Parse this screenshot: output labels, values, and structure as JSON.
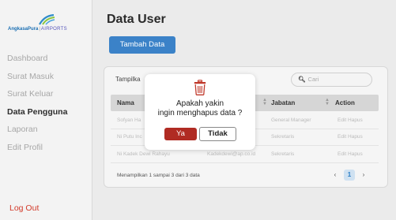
{
  "sidebar": {
    "logo": {
      "brand": "AngkasaPura",
      "separator": "|",
      "sub": "AIRPORTS",
      "icon": "angkasa-pura-logo-icon"
    },
    "items": [
      {
        "label": "Dashboard",
        "active": false
      },
      {
        "label": "Surat Masuk",
        "active": false
      },
      {
        "label": "Surat Keluar",
        "active": false
      },
      {
        "label": "Data Pengguna",
        "active": true
      },
      {
        "label": "Laporan",
        "active": false
      },
      {
        "label": "Edit Profil",
        "active": false
      }
    ],
    "logout_label": "Log Out",
    "logout_color": "#d23a2a"
  },
  "main": {
    "title": "Data User",
    "add_button_label": "Tambah Data",
    "accent_color": "#3b82c8",
    "show_label": "Tampilka",
    "search": {
      "icon": "search-icon",
      "placeholder": "Cari"
    },
    "table": {
      "columns": [
        "Nama",
        "Jabatan",
        "Action"
      ],
      "rows": [
        {
          "name": "Sofyan Ha",
          "email": "",
          "jabatan": "General Manager",
          "action": "Edit Hapus"
        },
        {
          "name": "Ni Putu Inc",
          "email": "",
          "jabatan": "Sekretaris",
          "action": "Edit Hapus"
        },
        {
          "name": "Ni Kadek Dewi Rahayu",
          "email": "Kadekdewi@ap.co.id",
          "jabatan": "Sekretaris",
          "action": "Edit Hapus"
        }
      ]
    },
    "info_text": "Menampilkan 1 sampai 3 dari 3 data",
    "pagination": {
      "prev": "‹",
      "current": "1",
      "next": "›"
    }
  },
  "modal": {
    "icon": "trash-icon",
    "message_line1": "Apakah yakin",
    "message_line2": "ingin menghapus data ?",
    "confirm_label": "Ya",
    "cancel_label": "Tidak",
    "confirm_color": "#b02b23",
    "icon_color": "#c0392b"
  }
}
